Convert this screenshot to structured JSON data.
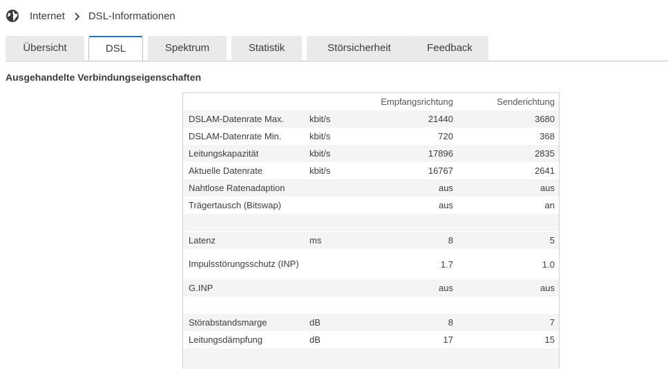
{
  "breadcrumb": {
    "root": "Internet",
    "current": "DSL-Informationen"
  },
  "tabs": [
    "Übersicht",
    "DSL",
    "Spektrum",
    "Statistik",
    "Störsicherheit",
    "Feedback"
  ],
  "active_tab": "DSL",
  "section_title": "Ausgehandelte Verbindungseigenschaften",
  "columns": {
    "rx": "Empfangsrichtung",
    "tx": "Senderichtung"
  },
  "rows": [
    {
      "label": "DSLAM-Datenrate Max.",
      "unit": "kbit/s",
      "rx": "21440",
      "tx": "3680"
    },
    {
      "label": "DSLAM-Datenrate Min.",
      "unit": "kbit/s",
      "rx": "720",
      "tx": "368"
    },
    {
      "label": "Leitungskapazität",
      "unit": "kbit/s",
      "rx": "17896",
      "tx": "2835"
    },
    {
      "label": "Aktuelle Datenrate",
      "unit": "kbit/s",
      "rx": "16767",
      "tx": "2641"
    },
    {
      "label": "Nahtlose Ratenadaption",
      "unit": "",
      "rx": "aus",
      "tx": "aus"
    },
    {
      "label": "Trägertausch (Bitswap)",
      "unit": "",
      "rx": "aus",
      "tx": "an"
    },
    {
      "label": "Latenz",
      "unit": "ms",
      "rx": "8",
      "tx": "5"
    },
    {
      "label": "Impulsstörungsschutz (INP)",
      "unit": "",
      "rx": "1.7",
      "tx": "1.0"
    },
    {
      "label": "G.INP",
      "unit": "",
      "rx": "aus",
      "tx": "aus"
    },
    {
      "label": "Störabstandsmarge",
      "unit": "dB",
      "rx": "8",
      "tx": "7"
    },
    {
      "label": "Leitungsdämpfung",
      "unit": "dB",
      "rx": "17",
      "tx": "15"
    }
  ]
}
